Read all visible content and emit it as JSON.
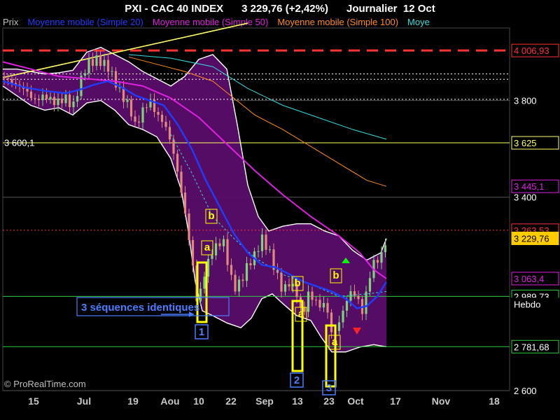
{
  "header": {
    "instrument": "PXI - CAC 40 INDEX",
    "quote": "3 229,76 (+2,42%)",
    "period": "Journalier",
    "date": "12 Oct"
  },
  "legend": [
    {
      "label": "Prix",
      "color": "#bfbfbf"
    },
    {
      "label": "Moyenne mobile (Simple 20)",
      "color": "#1f3cff"
    },
    {
      "label": "Moyenne mobile (Simple 50)",
      "color": "#e020e0"
    },
    {
      "label": "Moyenne mobile (Simple 100)",
      "color": "#ff8c1a"
    },
    {
      "label": "Moye",
      "color": "#33dddd"
    }
  ],
  "copyright": "© ProRealTime.com",
  "chart_data": {
    "type": "candlestick",
    "ylim": [
      2600,
      4100
    ],
    "y_ticks": [
      {
        "value": 3800,
        "label": "3 800"
      },
      {
        "value": 3400,
        "label": "3 400"
      },
      {
        "value": 2600,
        "label": "2 600"
      }
    ],
    "x_ticks": [
      "15",
      "Jul",
      "19",
      "Aou",
      "10",
      "22",
      "Sep",
      "13",
      "23",
      "Oct",
      "17",
      "Nov",
      "18"
    ],
    "price_tags": [
      {
        "label": "4 006,93",
        "value": 4006.93,
        "bg": "#000000",
        "fg": "#ff3333",
        "border": "#ff3333"
      },
      {
        "label": "3 625",
        "value": 3625,
        "bg": "#000000",
        "fg": "#ffff66",
        "border": "#ffff66"
      },
      {
        "label": "3 445,1",
        "value": 3445.1,
        "bg": "#000000",
        "fg": "#e020e0",
        "border": "#e020e0"
      },
      {
        "label": "3 263,53",
        "value": 3263.53,
        "bg": "#000000",
        "fg": "#ff3333",
        "border": "#ff3333"
      },
      {
        "label": "3 229,76",
        "value": 3229.76,
        "bg": "#ffcc00",
        "fg": "#000000",
        "border": "#ffcc00"
      },
      {
        "label": "3 063,4",
        "value": 3063.4,
        "bg": "#000000",
        "fg": "#e020e0",
        "border": "#e020e0"
      },
      {
        "label": "2 989,73",
        "value": 2989.73,
        "bg": "#000000",
        "fg": "#ffffff",
        "border": "#2ecc40"
      },
      {
        "label": "Hebdo",
        "value": 2957,
        "bg": "#000000",
        "fg": "#ffffff",
        "border": "#000000"
      },
      {
        "label": "2 781,68",
        "value": 2781.68,
        "bg": "#000000",
        "fg": "#ffffff",
        "border": "#2ecc40"
      }
    ],
    "hlines": [
      {
        "value": 4006.93,
        "color": "#ff3333",
        "style": "longdash"
      },
      {
        "value": 3910,
        "color": "#ffffff",
        "style": "dot"
      },
      {
        "value": 3888,
        "color": "#ffffff",
        "style": "dot"
      },
      {
        "value": 3805,
        "color": "#ffffff",
        "style": "dot"
      },
      {
        "value": 3625,
        "color": "#ffff66",
        "style": "solid"
      },
      {
        "value": 3263.53,
        "color": "#ff3333",
        "style": "dot"
      },
      {
        "value": 2989.73,
        "color": "#2ecc40",
        "style": "solid"
      },
      {
        "value": 2781.68,
        "color": "#2ecc40",
        "style": "solid"
      }
    ],
    "left_level_label": {
      "label": "3 600,1",
      "value": 3600.1
    },
    "trendline": {
      "from": [
        0,
        3895
      ],
      "to": [
        350,
        4120
      ],
      "color": "#ffff66"
    },
    "annotation_text": "3 séquences identiques",
    "sequence_numbers": [
      "1",
      "2",
      "3"
    ],
    "pattern_letters": [
      "a",
      "b"
    ],
    "series": [
      {
        "name": "Prix",
        "color": "#bfbfbf",
        "kind": "candles"
      },
      {
        "name": "Moyenne mobile (Simple 20)",
        "color": "#1f3cff"
      },
      {
        "name": "Moyenne mobile (Simple 50)",
        "color": "#e020e0"
      },
      {
        "name": "Moyenne mobile (Simple 100)",
        "color": "#ff8c1a"
      },
      {
        "name": "Moye",
        "color": "#33dddd"
      }
    ],
    "path_points": {
      "close": [
        [
          0,
          3900
        ],
        [
          15,
          3870
        ],
        [
          30,
          3850
        ],
        [
          45,
          3800
        ],
        [
          60,
          3820
        ],
        [
          75,
          3790
        ],
        [
          90,
          3810
        ],
        [
          100,
          3770
        ],
        [
          110,
          3870
        ],
        [
          120,
          3950
        ],
        [
          135,
          3970
        ],
        [
          150,
          3940
        ],
        [
          160,
          3880
        ],
        [
          170,
          3820
        ],
        [
          180,
          3780
        ],
        [
          190,
          3690
        ],
        [
          200,
          3760
        ],
        [
          210,
          3800
        ],
        [
          220,
          3740
        ],
        [
          230,
          3710
        ],
        [
          240,
          3630
        ],
        [
          250,
          3500
        ],
        [
          260,
          3340
        ],
        [
          270,
          3150
        ],
        [
          278,
          2950
        ],
        [
          285,
          3050
        ],
        [
          295,
          3150
        ],
        [
          305,
          3200
        ],
        [
          315,
          3220
        ],
        [
          322,
          3120
        ],
        [
          330,
          3020
        ],
        [
          340,
          3050
        ],
        [
          350,
          3120
        ],
        [
          360,
          3160
        ],
        [
          370,
          3230
        ],
        [
          380,
          3180
        ],
        [
          390,
          3090
        ],
        [
          400,
          3010
        ],
        [
          410,
          3050
        ],
        [
          420,
          3000
        ],
        [
          428,
          2900
        ],
        [
          436,
          3000
        ],
        [
          444,
          2980
        ],
        [
          452,
          2950
        ],
        [
          462,
          2960
        ],
        [
          470,
          2830
        ],
        [
          478,
          2860
        ],
        [
          486,
          2930
        ],
        [
          496,
          3010
        ],
        [
          506,
          2990
        ],
        [
          514,
          2920
        ],
        [
          522,
          3050
        ],
        [
          530,
          3130
        ],
        [
          540,
          3150
        ],
        [
          548,
          3229.76
        ]
      ],
      "bb_upper": [
        [
          0,
          3930
        ],
        [
          20,
          3930
        ],
        [
          40,
          3920
        ],
        [
          60,
          3910
        ],
        [
          80,
          3915
        ],
        [
          100,
          3925
        ],
        [
          120,
          4000
        ],
        [
          140,
          4020
        ],
        [
          160,
          3990
        ],
        [
          180,
          3960
        ],
        [
          200,
          3920
        ],
        [
          220,
          3890
        ],
        [
          240,
          3860
        ],
        [
          260,
          3900
        ],
        [
          280,
          3970
        ],
        [
          300,
          3990
        ],
        [
          320,
          3930
        ],
        [
          335,
          3700
        ],
        [
          350,
          3450
        ],
        [
          365,
          3320
        ],
        [
          380,
          3260
        ],
        [
          400,
          3280
        ],
        [
          420,
          3290
        ],
        [
          440,
          3290
        ],
        [
          460,
          3260
        ],
        [
          480,
          3240
        ],
        [
          500,
          3180
        ],
        [
          520,
          3140
        ],
        [
          540,
          3170
        ],
        [
          548,
          3229
        ]
      ],
      "bb_lower": [
        [
          0,
          3860
        ],
        [
          20,
          3820
        ],
        [
          40,
          3780
        ],
        [
          60,
          3760
        ],
        [
          80,
          3770
        ],
        [
          100,
          3740
        ],
        [
          120,
          3790
        ],
        [
          140,
          3800
        ],
        [
          160,
          3760
        ],
        [
          180,
          3700
        ],
        [
          200,
          3680
        ],
        [
          220,
          3650
        ],
        [
          240,
          3560
        ],
        [
          255,
          3430
        ],
        [
          265,
          3260
        ],
        [
          275,
          3050
        ],
        [
          285,
          2930
        ],
        [
          300,
          2910
        ],
        [
          320,
          2880
        ],
        [
          340,
          2860
        ],
        [
          355,
          2900
        ],
        [
          370,
          2980
        ],
        [
          385,
          3000
        ],
        [
          400,
          2960
        ],
        [
          420,
          2910
        ],
        [
          440,
          2890
        ],
        [
          455,
          2820
        ],
        [
          470,
          2760
        ],
        [
          490,
          2760
        ],
        [
          510,
          2780
        ],
        [
          530,
          2790
        ],
        [
          548,
          2781
        ]
      ],
      "ma20": [
        [
          0,
          3880
        ],
        [
          30,
          3855
        ],
        [
          60,
          3840
        ],
        [
          90,
          3830
        ],
        [
          110,
          3845
        ],
        [
          130,
          3865
        ],
        [
          150,
          3880
        ],
        [
          170,
          3855
        ],
        [
          190,
          3820
        ],
        [
          210,
          3800
        ],
        [
          230,
          3780
        ],
        [
          250,
          3700
        ],
        [
          270,
          3600
        ],
        [
          290,
          3470
        ],
        [
          310,
          3360
        ],
        [
          330,
          3250
        ],
        [
          350,
          3170
        ],
        [
          370,
          3120
        ],
        [
          390,
          3110
        ],
        [
          410,
          3080
        ],
        [
          430,
          3050
        ],
        [
          450,
          3030
        ],
        [
          470,
          3010
        ],
        [
          490,
          2980
        ],
        [
          506,
          2940
        ],
        [
          520,
          2950
        ],
        [
          535,
          2990
        ],
        [
          548,
          3050
        ]
      ],
      "ma50": [
        [
          0,
          3960
        ],
        [
          40,
          3930
        ],
        [
          80,
          3900
        ],
        [
          120,
          3890
        ],
        [
          160,
          3880
        ],
        [
          200,
          3860
        ],
        [
          240,
          3810
        ],
        [
          280,
          3730
        ],
        [
          320,
          3620
        ],
        [
          360,
          3510
        ],
        [
          400,
          3410
        ],
        [
          440,
          3320
        ],
        [
          480,
          3240
        ],
        [
          510,
          3170
        ],
        [
          530,
          3100
        ],
        [
          548,
          3063
        ]
      ],
      "ma100": [
        [
          180,
          3980
        ],
        [
          220,
          3950
        ],
        [
          260,
          3920
        ],
        [
          300,
          3880
        ],
        [
          330,
          3810
        ],
        [
          360,
          3740
        ],
        [
          400,
          3680
        ],
        [
          440,
          3610
        ],
        [
          480,
          3540
        ],
        [
          520,
          3470
        ],
        [
          548,
          3445
        ]
      ],
      "ma_cyan": [
        [
          180,
          3990
        ],
        [
          240,
          3975
        ],
        [
          300,
          3940
        ],
        [
          350,
          3850
        ],
        [
          400,
          3780
        ],
        [
          450,
          3730
        ],
        [
          500,
          3680
        ],
        [
          548,
          3640
        ]
      ],
      "ma20_dashed": [
        [
          240,
          3660
        ],
        [
          270,
          3500
        ],
        [
          300,
          3320
        ],
        [
          330,
          3230
        ],
        [
          360,
          3150
        ],
        [
          400,
          3080
        ],
        [
          440,
          3040
        ],
        [
          480,
          2990
        ],
        [
          520,
          3000
        ],
        [
          548,
          3010
        ]
      ]
    }
  }
}
